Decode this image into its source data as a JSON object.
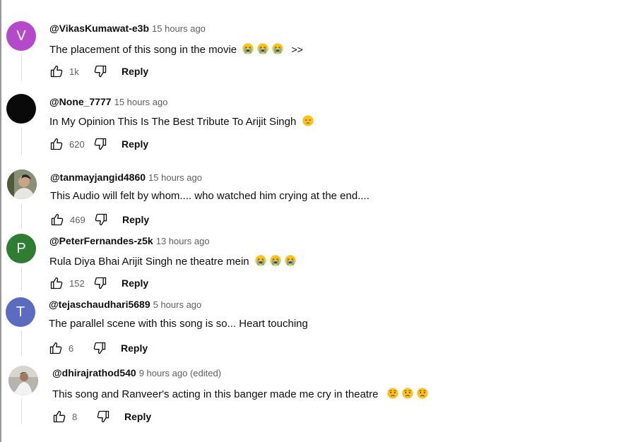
{
  "comments": [
    {
      "author": "@VikasKumawat-e3b",
      "time": "15 hours ago",
      "text": "The placement of this song in the movie",
      "text_suffix": ">>",
      "emojis": [
        "loudly-crying-face",
        "loudly-crying-face",
        "loudly-crying-face"
      ],
      "likes": "1k",
      "reply_label": "Reply",
      "avatar": {
        "letter": "V",
        "color": "#b44ac9"
      }
    },
    {
      "author": "@None_7777",
      "time": "15 hours ago",
      "text": "In My Opinion This Is The Best Tribute To Arijit Singh",
      "emojis": [
        "pensive-face"
      ],
      "likes": "620",
      "reply_label": "Reply",
      "avatar": {
        "letter": "",
        "color": "#0a0a0a"
      }
    },
    {
      "author": "@tanmayjangid4860",
      "time": "15 hours ago",
      "text": "This Audio will felt by whom.... who watched him crying at the end....",
      "emojis": [],
      "likes": "469",
      "reply_label": "Reply",
      "avatar": {
        "letter": "",
        "color": "#6b6f5e"
      }
    },
    {
      "author": "@PeterFernandes-z5k",
      "time": "13 hours ago",
      "text": "Rula Diya Bhai Arijit Singh ne theatre mein",
      "emojis": [
        "loudly-crying-face",
        "loudly-crying-face",
        "loudly-crying-face"
      ],
      "likes": "152",
      "reply_label": "Reply",
      "avatar": {
        "letter": "P",
        "color": "#2e7d32"
      }
    },
    {
      "author": "@tejaschaudhari5689",
      "time": "5 hours ago",
      "text": "The parallel scene with this song is so... Heart touching",
      "emojis": [],
      "likes": "6",
      "reply_label": "Reply",
      "avatar": {
        "letter": "T",
        "color": "#5c6bc0"
      }
    },
    {
      "author": "@dhirajrathod540",
      "time": "9 hours ago (edited)",
      "text": "This song and Ranveer's acting in this banger made me cry in theatre",
      "emojis": [
        "worried-face",
        "worried-face",
        "worried-face"
      ],
      "likes": "8",
      "reply_label": "Reply",
      "avatar": {
        "letter": "",
        "color": "#9e9e9e"
      }
    }
  ]
}
